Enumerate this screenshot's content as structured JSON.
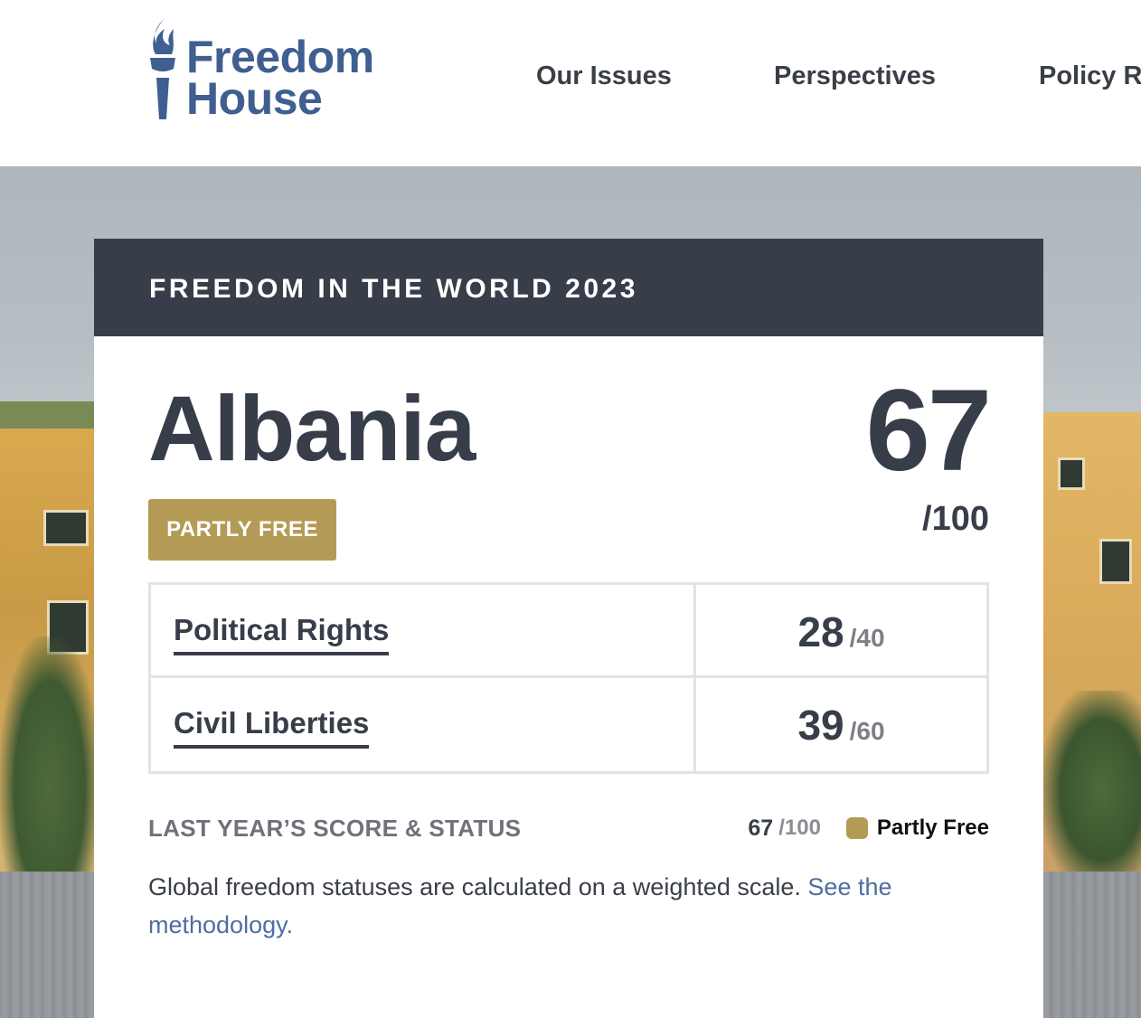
{
  "header": {
    "logo": {
      "line1": "Freedom",
      "line2": "House"
    },
    "nav": [
      {
        "label": "Our Issues"
      },
      {
        "label": "Perspectives"
      },
      {
        "label": "Policy Re"
      }
    ]
  },
  "card": {
    "banner": "FREEDOM IN THE WORLD 2023",
    "country": "Albania",
    "status": "PARTLY FREE",
    "total_score": "67",
    "total_max": "/100",
    "categories": [
      {
        "label": "Political Rights",
        "score": "28",
        "max": "/40"
      },
      {
        "label": "Civil Liberties",
        "score": "39",
        "max": "/60"
      }
    ],
    "last_year": {
      "label": "LAST YEAR’S SCORE & STATUS",
      "score": "67",
      "max": "/100",
      "status": "Partly Free"
    },
    "methodology": {
      "text": "Global freedom statuses are calculated on a weighted scale. ",
      "link": "See the methodology."
    }
  },
  "colors": {
    "brand_blue": "#3f5f90",
    "banner_dark": "#373d49",
    "partly_free_gold": "#b49b55",
    "link_blue": "#4e6e9f"
  },
  "icons": {
    "logo_icon": "torch-icon",
    "status_dot": "status-dot-icon"
  }
}
